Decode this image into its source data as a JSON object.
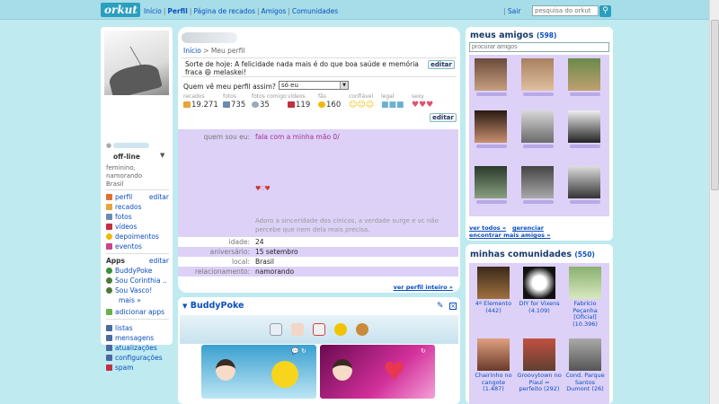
{
  "topbar": {
    "logo": "orkut",
    "nav": [
      "Início",
      "Perfil",
      "Página de recados",
      "Amigos",
      "Comunidades"
    ],
    "sair": "Sair",
    "search_placeholder": "pesquisa do orkut"
  },
  "profile": {
    "status": "off-line",
    "bio": "feminino,\nnamorando\nBrasil",
    "breadcrumb_home": "Início",
    "breadcrumb_current": "Meu perfil",
    "fortune": "Sorte de hoje: A felicidade nada mais é do que boa saúde e memória fraca 😄 melaskei!",
    "edit_label": "editar",
    "who_sees_label": "Quem vê meu perfil assim?",
    "who_sees_value": "só eu",
    "stats": [
      {
        "label": "recados",
        "value": "19.271",
        "color": "#e8a33a"
      },
      {
        "label": "fotos",
        "value": "735",
        "color": "#6a8bb0"
      },
      {
        "label": "fotos comigo",
        "value": "35",
        "color": "#99aabb"
      },
      {
        "label": "vídeos",
        "value": "119",
        "color": "#c03040"
      },
      {
        "label": "fãs",
        "value": "160",
        "color": "#f2b800"
      }
    ],
    "stat_labels_extra": [
      "confiável",
      "legal",
      "sexy"
    ],
    "about_key": "quem sou eu:",
    "about_value": "fala com a minha mão 0/",
    "about_glitter": "♥♡♥",
    "about_quote": "Adoro a sinceridade dos cínicos, a verdade surge e vc não percebe que nem dela mais precisa.",
    "rows": [
      {
        "key": "idade:",
        "value": "24"
      },
      {
        "key": "aniversário:",
        "value": "15 setembro"
      },
      {
        "key": "local:",
        "value": "Brasil"
      },
      {
        "key": "relacionamento:",
        "value": "namorando"
      }
    ],
    "see_full": "ver perfil inteiro »"
  },
  "left_menu": {
    "profile_items": [
      {
        "label": "perfil",
        "color": "#e07030"
      },
      {
        "label": "recados",
        "color": "#e8a33a"
      },
      {
        "label": "fotos",
        "color": "#6a8bb0"
      },
      {
        "label": "vídeos",
        "color": "#c03040"
      },
      {
        "label": "depoimentos",
        "color": "#f2b800"
      },
      {
        "label": "eventos",
        "color": "#cc4488"
      }
    ],
    "edit_label": "editar",
    "apps_title": "Apps",
    "apps_edit": "editar",
    "apps": [
      {
        "label": "BuddyPoke",
        "color": "#3a8e3a"
      },
      {
        "label": "Sou Corinthia ..",
        "color": "#4a7a3a"
      },
      {
        "label": "Sou Vasco!",
        "color": "#4a7a3a"
      }
    ],
    "apps_more": "mais »",
    "add_apps": "adicionar apps",
    "settings_items": [
      {
        "label": "listas",
        "color": "#4a6aa0"
      },
      {
        "label": "mensagens",
        "color": "#4a6aa0"
      },
      {
        "label": "atualizações",
        "color": "#4a6aa0"
      },
      {
        "label": "configurações",
        "color": "#4a6aa0"
      },
      {
        "label": "spam",
        "color": "#c03040"
      }
    ]
  },
  "buddypoke": {
    "title": "BuddyPoke"
  },
  "friends": {
    "title": "meus amigos",
    "count": "(598)",
    "search_placeholder": "procurar amigos",
    "see_all": "ver todos »",
    "manage": "gerenciar",
    "find_more": "encontrar mais amigos »"
  },
  "communities": {
    "title": "minhas comunidades",
    "count": "(550)",
    "items": [
      {
        "name": "4º Elemento (442)"
      },
      {
        "name": "DIY for Vixens (4.109)"
      },
      {
        "name": "Fabrício Peçanha [Oficial] (10.396)"
      },
      {
        "name": "Chairinho no cangote (1.487)"
      },
      {
        "name": "Groovytown no Piauí = perfeito (292)"
      },
      {
        "name": "Cond. Parque Santos Dumont (26)"
      }
    ]
  }
}
